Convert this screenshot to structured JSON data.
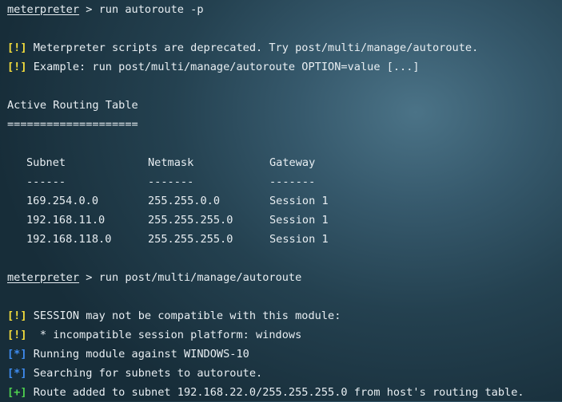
{
  "terminal": {
    "prompt": "meterpreter",
    "first_command": {
      "separator": " > ",
      "text": "run autoroute -p"
    },
    "deprecation_messages": [
      {
        "marker": "[!]",
        "text": " Meterpreter scripts are deprecated. Try post/multi/manage/autoroute."
      },
      {
        "marker": "[!]",
        "text": " Example: run post/multi/manage/autoroute OPTION=value [...]"
      }
    ],
    "routing_table": {
      "title": "Active Routing Table",
      "underline": "====================",
      "headers": [
        "Subnet",
        "Netmask",
        "Gateway"
      ],
      "dividers": [
        "------",
        "-------",
        "-------"
      ],
      "rows": [
        [
          "169.254.0.0",
          "255.255.0.0",
          "Session 1"
        ],
        [
          "192.168.11.0",
          "255.255.255.0",
          "Session 1"
        ],
        [
          "192.168.118.0",
          "255.255.255.0",
          "Session 1"
        ]
      ]
    },
    "second_command": {
      "separator": " > ",
      "text": "run post/multi/manage/autoroute"
    },
    "module_messages": [
      {
        "marker": "[!]",
        "type": "warning",
        "text": " SESSION may not be compatible with this module:"
      },
      {
        "marker": "[!]",
        "type": "warning",
        "text": "  * incompatible session platform: windows"
      },
      {
        "marker": "[*]",
        "type": "info",
        "text": " Running module against WINDOWS-10"
      },
      {
        "marker": "[*]",
        "type": "info",
        "text": " Searching for subnets to autoroute."
      },
      {
        "marker": "[+]",
        "type": "success",
        "text": " Route added to subnet 192.168.22.0/255.255.255.0 from host's routing table."
      }
    ],
    "colors": {
      "warning": "#f6df3c",
      "info": "#3f8df2",
      "success": "#4fd34f",
      "text": "#e8eef2"
    }
  }
}
